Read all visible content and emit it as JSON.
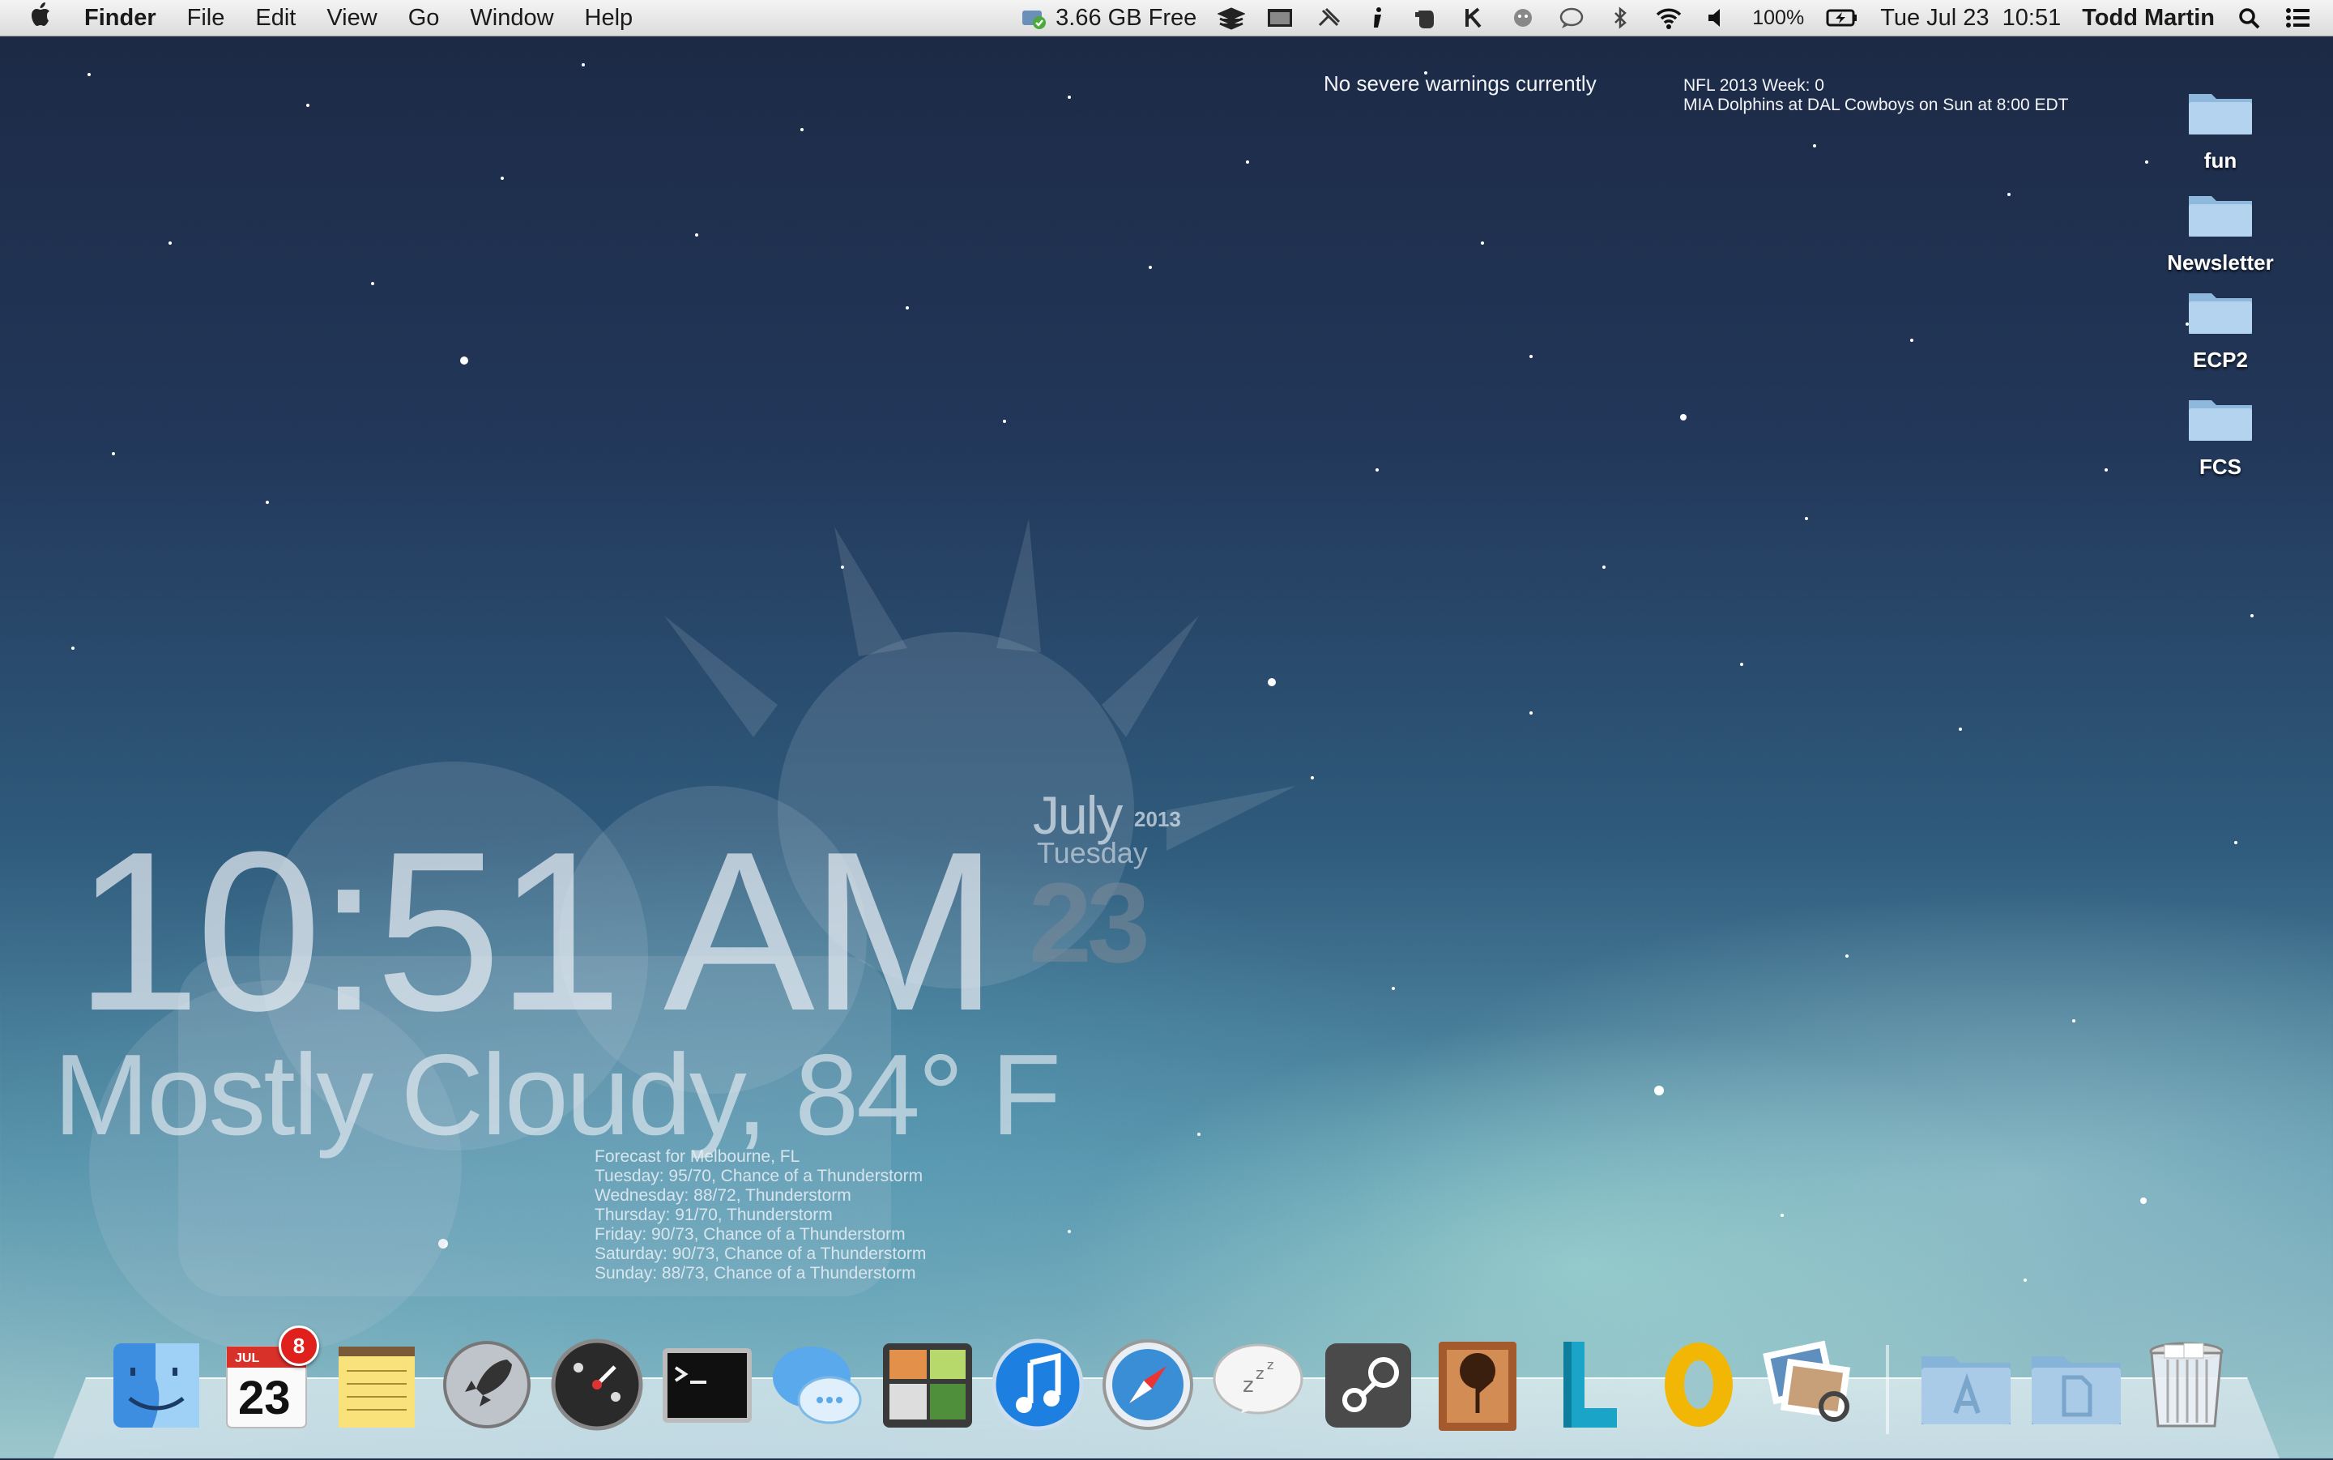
{
  "menubar": {
    "app_name": "Finder",
    "menus": [
      "File",
      "Edit",
      "View",
      "Go",
      "Window",
      "Help"
    ],
    "disk_free": "3.66 GB Free",
    "battery": "100%",
    "datetime": "Tue Jul 23  10:51",
    "user": "Todd Martin"
  },
  "widgets": {
    "warnings": "No severe warnings currently",
    "nfl_week": "NFL 2013 Week: 0",
    "nfl_game": "MIA Dolphins at DAL Cowboys on Sun at 8:00 EDT",
    "clock": "10:51 AM",
    "month": "July",
    "year": "2013",
    "weekday": "Tuesday",
    "day": "23",
    "conditions": "Mostly Cloudy, 84° F",
    "forecast": [
      "Forecast for Melbourne, FL",
      "Tuesday: 95/70, Chance of a Thunderstorm",
      "Wednesday: 88/72, Thunderstorm",
      "Thursday: 91/70, Thunderstorm",
      "Friday: 90/73, Chance of a Thunderstorm",
      "Saturday: 90/73, Chance of a Thunderstorm",
      "Sunday: 88/73, Chance of a Thunderstorm"
    ]
  },
  "desktop_folders": [
    "fun",
    "Newsletter",
    "ECP2",
    "FCS"
  ],
  "dock": {
    "calendar_month": "JUL",
    "calendar_day": "23",
    "calendar_badge": "8",
    "apps": [
      "finder",
      "calendar",
      "notes",
      "launchpad",
      "dashboard",
      "terminal",
      "messages",
      "photo-booth",
      "itunes",
      "safari",
      "caffeine",
      "steam",
      "family-tree",
      "l-app",
      "o-app",
      "preview"
    ]
  }
}
